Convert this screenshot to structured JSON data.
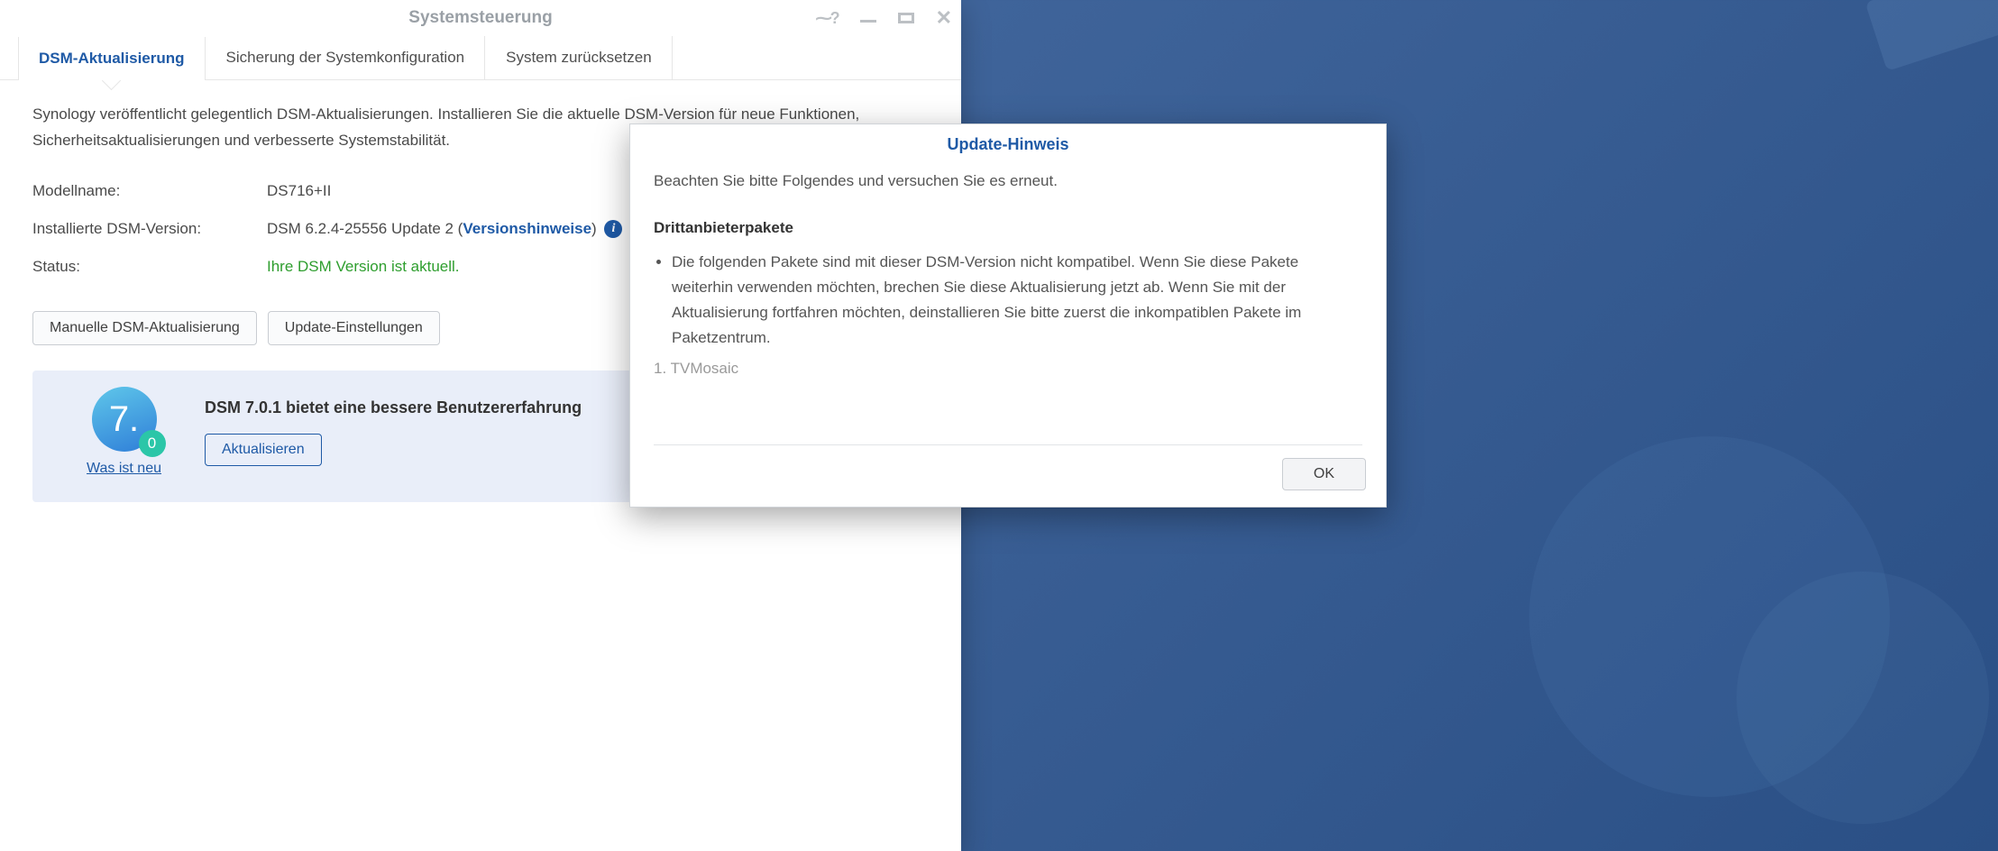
{
  "window": {
    "title": "Systemsteuerung"
  },
  "tabs": {
    "dsm_update": "DSM-Aktualisierung",
    "backup": "Sicherung der Systemkonfiguration",
    "reset": "System zurücksetzen"
  },
  "intro": "Synology veröffentlicht gelegentlich DSM-Aktualisierungen. Installieren Sie die aktuelle DSM-Version für neue Funktionen, Sicherheitsaktualisierungen und verbesserte Systemstabilität.",
  "info": {
    "model_label": "Modellname:",
    "model_value": "DS716+II",
    "version_label": "Installierte DSM-Version:",
    "version_value_prefix": "DSM 6.2.4-25556 Update 2 (",
    "version_link": "Versionshinweise",
    "version_value_suffix": ")",
    "status_label": "Status:",
    "status_value": "Ihre DSM Version ist aktuell."
  },
  "buttons": {
    "manual_update": "Manuelle DSM-Aktualisierung",
    "settings": "Update-Einstellungen"
  },
  "promo": {
    "badge_main": "7.",
    "badge_sub": "0",
    "whats_new": "Was ist neu",
    "headline": "DSM 7.0.1 bietet eine bessere Benutzererfahrung",
    "update_btn": "Aktualisieren"
  },
  "dialog": {
    "title": "Update-Hinweis",
    "lead": "Beachten Sie bitte Folgendes und versuchen Sie es erneut.",
    "section_title": "Drittanbieterpakete",
    "bullet": "Die folgenden Pakete sind mit dieser DSM-Version nicht kompatibel. Wenn Sie diese Pakete weiterhin verwenden möchten, brechen Sie diese Aktualisierung jetzt ab. Wenn Sie mit der Aktualisierung fortfahren möchten, deinstallieren Sie bitte zuerst die inkompatiblen Pakete im Paketzentrum.",
    "pkg1": "1. TVMosaic",
    "ok": "OK"
  }
}
